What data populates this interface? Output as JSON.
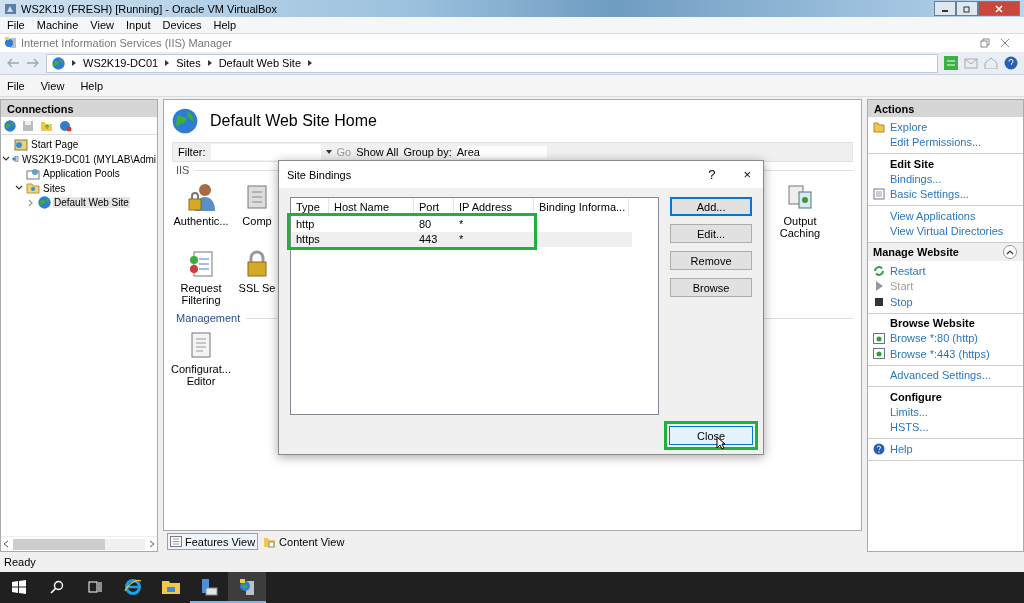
{
  "vm_window": {
    "title": "WS2K19 (FRESH) [Running] - Oracle VM VirtualBox",
    "menu": [
      "File",
      "Machine",
      "View",
      "Input",
      "Devices",
      "Help"
    ]
  },
  "app_window": {
    "title": "Internet Information Services (IIS) Manager"
  },
  "address_bar": {
    "breadcrumb": [
      "WS2K19-DC01",
      "Sites",
      "Default Web Site"
    ]
  },
  "menu": [
    "File",
    "View",
    "Help"
  ],
  "connections": {
    "title": "Connections",
    "tree": [
      {
        "label": "Start Page",
        "selected": false
      },
      {
        "label": "WS2K19-DC01 (MYLAB\\Admi",
        "expanded": true,
        "selected": false,
        "children": [
          {
            "label": "Application Pools",
            "selected": false
          },
          {
            "label": "Sites",
            "expanded": true,
            "selected": false,
            "children": [
              {
                "label": "Default Web Site",
                "expanded": false,
                "selected": true
              }
            ]
          }
        ]
      }
    ]
  },
  "home": {
    "title": "Default Web Site Home",
    "filter": {
      "label": "Filter:",
      "go": "Go",
      "show_all": "Show All",
      "group_by": "Group by:",
      "group_value": "Area"
    },
    "groups": [
      {
        "title": "IIS",
        "rows": [
          [
            {
              "label": "Authentic..."
            },
            {
              "label": "Comp"
            },
            {
              "label": "Output Caching"
            }
          ],
          [
            {
              "label": "Request Filtering"
            },
            {
              "label": "SSL Se"
            }
          ]
        ]
      },
      {
        "title": "Management",
        "rows": [
          [
            {
              "label": "Configurat... Editor"
            }
          ]
        ]
      }
    ]
  },
  "view_tabs": [
    {
      "label": "Features View",
      "selected": true
    },
    {
      "label": "Content View",
      "selected": false
    }
  ],
  "status": "Ready",
  "actions": {
    "title": "Actions",
    "sections": [
      {
        "items": [
          {
            "label": "Explore",
            "disabled": false
          },
          {
            "label": "Edit Permissions...",
            "disabled": false
          }
        ]
      },
      {
        "heading": {
          "text": "Edit Site",
          "kind": "sub"
        },
        "items": [
          {
            "label": "Bindings...",
            "disabled": false
          },
          {
            "label": "Basic Settings...",
            "disabled": false
          }
        ]
      },
      {
        "items": [
          {
            "label": "View Applications",
            "disabled": false
          },
          {
            "label": "View Virtual Directories",
            "disabled": false
          }
        ]
      },
      {
        "heading": {
          "text": "Manage Website",
          "kind": "group",
          "expanded": true
        },
        "items": [
          {
            "label": "Restart",
            "disabled": false
          },
          {
            "label": "Start",
            "disabled": true
          },
          {
            "label": "Stop",
            "disabled": false
          }
        ]
      },
      {
        "heading": {
          "text": "Browse Website",
          "kind": "sub"
        },
        "items": [
          {
            "label": "Browse *:80 (http)",
            "disabled": false
          },
          {
            "label": "Browse *:443 (https)",
            "disabled": false
          }
        ]
      },
      {
        "items": [
          {
            "label": "Advanced Settings...",
            "disabled": false
          }
        ]
      },
      {
        "heading": {
          "text": "Configure",
          "kind": "sub"
        },
        "items": [
          {
            "label": "Limits...",
            "disabled": false
          },
          {
            "label": "HSTS...",
            "disabled": false
          }
        ]
      },
      {
        "items": [
          {
            "label": "Help",
            "disabled": false
          }
        ]
      }
    ]
  },
  "dialog": {
    "title": "Site Bindings",
    "help": "?",
    "close": "×",
    "columns": [
      "Type",
      "Host Name",
      "Port",
      "IP Address",
      "Binding Informa..."
    ],
    "rows": [
      {
        "type": "http",
        "port": "80",
        "ip_address": "*",
        "selected": false
      },
      {
        "type": "https",
        "port": "443",
        "ip_address": "*",
        "selected": true
      }
    ],
    "buttons": [
      {
        "label": "Add...",
        "focused": true
      },
      {
        "label": "Edit...",
        "focused": false
      },
      {
        "label": "Remove",
        "focused": false
      },
      {
        "label": "Browse",
        "focused": false
      }
    ],
    "close_button": {
      "label": "Close",
      "hovered": true
    }
  },
  "taskbar": [
    {
      "running": false,
      "selected": false
    },
    {
      "running": false,
      "selected": false
    },
    {
      "running": false,
      "selected": false
    },
    {
      "running": false,
      "selected": false
    },
    {
      "running": false,
      "selected": false
    },
    {
      "running": true,
      "selected": false
    },
    {
      "running": true,
      "selected": true
    }
  ]
}
